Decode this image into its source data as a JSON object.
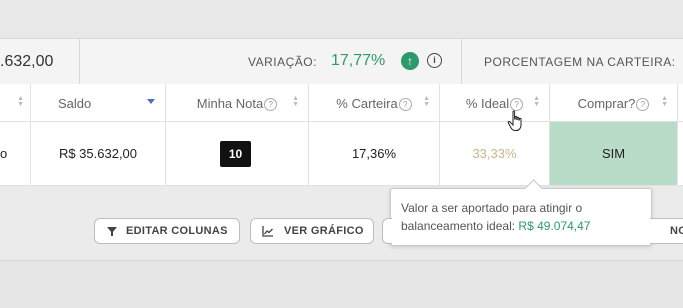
{
  "stats": {
    "balance_partial": ".632,00",
    "variation_label": "VARIAÇÃO:",
    "variation_value": "17,77%",
    "portfolio_pct_label": "PORCENTAGEM NA CARTEIRA:"
  },
  "table": {
    "headers": {
      "saldo": "Saldo",
      "minha_nota": "Minha Nota",
      "carteira": "% Carteira",
      "ideal": "% Ideal",
      "comprar": "Comprar?"
    },
    "row": {
      "partial": "o",
      "saldo": "R$ 35.632,00",
      "nota": "10",
      "carteira": "17,36%",
      "ideal": "33,33%",
      "comprar": "SIM"
    }
  },
  "tooltip": {
    "line1": "Valor a ser aportado para atingir o",
    "line2_prefix": "balanceamento ideal: ",
    "value": "R$ 49.074,47"
  },
  "actions": {
    "edit_columns": "EDITAR COLUNAS",
    "view_chart": "VER GRÁFICO",
    "right_partial": "NO"
  },
  "colors": {
    "positive": "#2e9a6a",
    "buy_cell": "#b8dcc8",
    "ideal_text": "#c9b58a"
  }
}
